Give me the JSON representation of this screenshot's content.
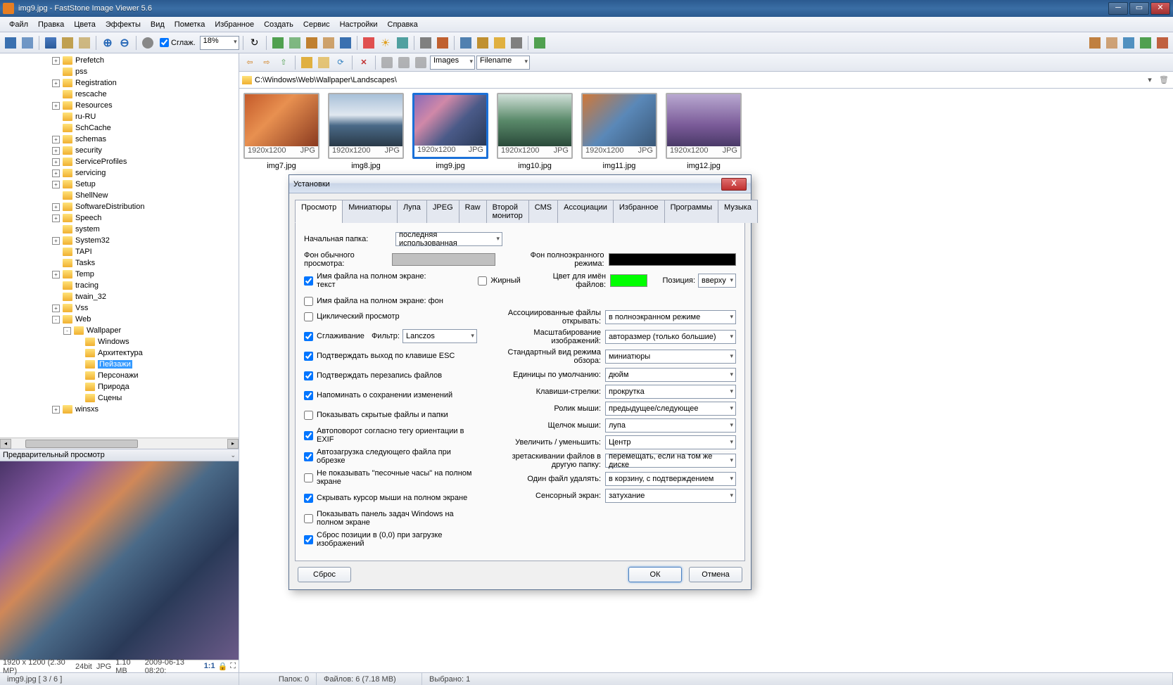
{
  "titlebar": {
    "text": "img9.jpg  -  FastStone Image Viewer 5.6"
  },
  "menubar": [
    "Файл",
    "Правка",
    "Цвета",
    "Эффекты",
    "Вид",
    "Пометка",
    "Избранное",
    "Создать",
    "Сервис",
    "Настройки",
    "Справка"
  ],
  "toolbar": {
    "smooth_label": "Сглаж.",
    "zoom_value": "18%"
  },
  "tree": {
    "nodes": [
      {
        "indent": 2,
        "exp": "+",
        "label": "Prefetch"
      },
      {
        "indent": 2,
        "exp": "",
        "label": "pss"
      },
      {
        "indent": 2,
        "exp": "+",
        "label": "Registration"
      },
      {
        "indent": 2,
        "exp": "",
        "label": "rescache"
      },
      {
        "indent": 2,
        "exp": "+",
        "label": "Resources"
      },
      {
        "indent": 2,
        "exp": "",
        "label": "ru-RU"
      },
      {
        "indent": 2,
        "exp": "",
        "label": "SchCache"
      },
      {
        "indent": 2,
        "exp": "+",
        "label": "schemas"
      },
      {
        "indent": 2,
        "exp": "+",
        "label": "security"
      },
      {
        "indent": 2,
        "exp": "+",
        "label": "ServiceProfiles"
      },
      {
        "indent": 2,
        "exp": "+",
        "label": "servicing"
      },
      {
        "indent": 2,
        "exp": "+",
        "label": "Setup"
      },
      {
        "indent": 2,
        "exp": "",
        "label": "ShellNew"
      },
      {
        "indent": 2,
        "exp": "+",
        "label": "SoftwareDistribution"
      },
      {
        "indent": 2,
        "exp": "+",
        "label": "Speech"
      },
      {
        "indent": 2,
        "exp": "",
        "label": "system"
      },
      {
        "indent": 2,
        "exp": "+",
        "label": "System32"
      },
      {
        "indent": 2,
        "exp": "",
        "label": "TAPI"
      },
      {
        "indent": 2,
        "exp": "",
        "label": "Tasks"
      },
      {
        "indent": 2,
        "exp": "+",
        "label": "Temp"
      },
      {
        "indent": 2,
        "exp": "",
        "label": "tracing"
      },
      {
        "indent": 2,
        "exp": "",
        "label": "twain_32"
      },
      {
        "indent": 2,
        "exp": "+",
        "label": "Vss"
      },
      {
        "indent": 2,
        "exp": "-",
        "label": "Web"
      },
      {
        "indent": 3,
        "exp": "-",
        "label": "Wallpaper"
      },
      {
        "indent": 4,
        "exp": "",
        "label": "Windows"
      },
      {
        "indent": 4,
        "exp": "",
        "label": "Архитектура"
      },
      {
        "indent": 4,
        "exp": "",
        "label": "Пейзажи",
        "selected": true
      },
      {
        "indent": 4,
        "exp": "",
        "label": "Персонажи"
      },
      {
        "indent": 4,
        "exp": "",
        "label": "Природа"
      },
      {
        "indent": 4,
        "exp": "",
        "label": "Сцены"
      },
      {
        "indent": 2,
        "exp": "+",
        "label": "winsxs"
      }
    ]
  },
  "preview": {
    "header": "Предварительный просмотр",
    "info_res": "1920 x 1200 (2.30 MP)",
    "info_bit": "24bit",
    "info_fmt": "JPG",
    "info_size": "1.10 MB",
    "info_date": "2009-06-13 08:20:",
    "info_zoom": "1:1"
  },
  "nav": {
    "filter1": "Images",
    "filter2": "Filename"
  },
  "addr": {
    "path": "C:\\Windows\\Web\\Wallpaper\\Landscapes\\"
  },
  "thumbs": [
    {
      "res": "1920x1200",
      "fmt": "JPG",
      "name": "img7.jpg",
      "bg": "linear-gradient(135deg,#c45a2a,#e89050 40%,#8a3a20)"
    },
    {
      "res": "1920x1200",
      "fmt": "JPG",
      "name": "img8.jpg",
      "bg": "linear-gradient(180deg,#a8c0d8 0%,#e0e8f0 40%,#4a6a88 60%,#2a3a48)"
    },
    {
      "res": "1920x1200",
      "fmt": "JPG",
      "name": "img9.jpg",
      "bg": "linear-gradient(135deg,#8a6ab8,#d088a8 30%,#4a5a88 60%,#2a3a58)",
      "selected": true
    },
    {
      "res": "1920x1200",
      "fmt": "JPG",
      "name": "img10.jpg",
      "bg": "linear-gradient(180deg,#d0e0d8 0%,#5a8a6a 50%,#2a4a3a)"
    },
    {
      "res": "1920x1200",
      "fmt": "JPG",
      "name": "img11.jpg",
      "bg": "linear-gradient(135deg,#d07838,#5a88b8 50%,#3a5878)"
    },
    {
      "res": "1920x1200",
      "fmt": "JPG",
      "name": "img12.jpg",
      "bg": "linear-gradient(180deg,#b8a8d0 0%,#7a5a98 60%,#4a3a68)"
    }
  ],
  "statusbar": {
    "file": "img9.jpg [ 3 / 6 ]",
    "folders": "Папок: 0",
    "files": "Файлов: 6 (7.18 MB)",
    "selected": "Выбрано: 1"
  },
  "dialog": {
    "title": "Установки",
    "tabs": [
      "Просмотр",
      "Миниатюры",
      "Лупа",
      "JPEG",
      "Raw",
      "Второй монитор",
      "CMS",
      "Ассоциации",
      "Избранное",
      "Программы",
      "Музыка"
    ],
    "active_tab": 0,
    "start_folder_label": "Начальная папка:",
    "start_folder_value": "последняя использованная",
    "bg_normal_label": "Фон обычного просмотра:",
    "bg_normal_color": "#c0c0c0",
    "bg_full_label": "Фон полноэкранного режима:",
    "bg_full_color": "#000000",
    "name_text_label": "Имя файла на полном экране: текст",
    "name_text_checked": true,
    "bold_label": "Жирный",
    "bold_checked": false,
    "name_color_label": "Цвет для имён файлов:",
    "name_color": "#00ff00",
    "pos_label": "Позиция:",
    "pos_value": "вверху",
    "name_bg_label": "Имя файла на полном экране: фон",
    "name_bg_checked": false,
    "cyclic_label": "Циклический просмотр",
    "cyclic_checked": false,
    "smooth_label": "Сглаживание",
    "smooth_checked": true,
    "filter_label": "Фильтр:",
    "filter_value": "Lanczos",
    "checks": [
      {
        "label": "Подтверждать выход по клавише ESC",
        "checked": true
      },
      {
        "label": "Подтверждать перезапись файлов",
        "checked": true
      },
      {
        "label": "Напоминать о сохранении изменений",
        "checked": true
      },
      {
        "label": "Показывать скрытые файлы и папки",
        "checked": false
      },
      {
        "label": "Автоповорот согласно тегу ориентации в EXIF",
        "checked": true
      },
      {
        "label": "Автозагрузка следующего файла при обрезке",
        "checked": true
      },
      {
        "label": "Не показывать \"песочные часы\" на полном экране",
        "checked": false
      },
      {
        "label": "Скрывать курсор мыши на полном экране",
        "checked": true
      },
      {
        "label": "Показывать панель задач Windows на полном экране",
        "checked": false
      },
      {
        "label": "Сброс позиции в (0,0) при загрузке изображений",
        "checked": true
      }
    ],
    "rights": [
      {
        "label": "Ассоциированные файлы открывать:",
        "value": "в полноэкранном режиме"
      },
      {
        "label": "Масштабирование изображений:",
        "value": "авторазмер (только большие)"
      },
      {
        "label": "Стандартный вид режима обзора:",
        "value": "миниатюры"
      },
      {
        "label": "Единицы по умолчанию:",
        "value": "дюйм"
      },
      {
        "label": "Клавиши-стрелки:",
        "value": "прокрутка"
      },
      {
        "label": "Ролик мыши:",
        "value": "предыдущее/следующее"
      },
      {
        "label": "Щелчок мыши:",
        "value": "лупа"
      },
      {
        "label": "Увеличить / уменьшить:",
        "value": "Центр"
      },
      {
        "label": "зретаскивании файлов в другую папку:",
        "value": "перемещать, если на том же диске"
      },
      {
        "label": "Один файл удалять:",
        "value": "в корзину, с подтверждением"
      },
      {
        "label": "Сенсорный экран:",
        "value": "затухание"
      }
    ],
    "btn_reset": "Сброс",
    "btn_ok": "ОК",
    "btn_cancel": "Отмена"
  }
}
